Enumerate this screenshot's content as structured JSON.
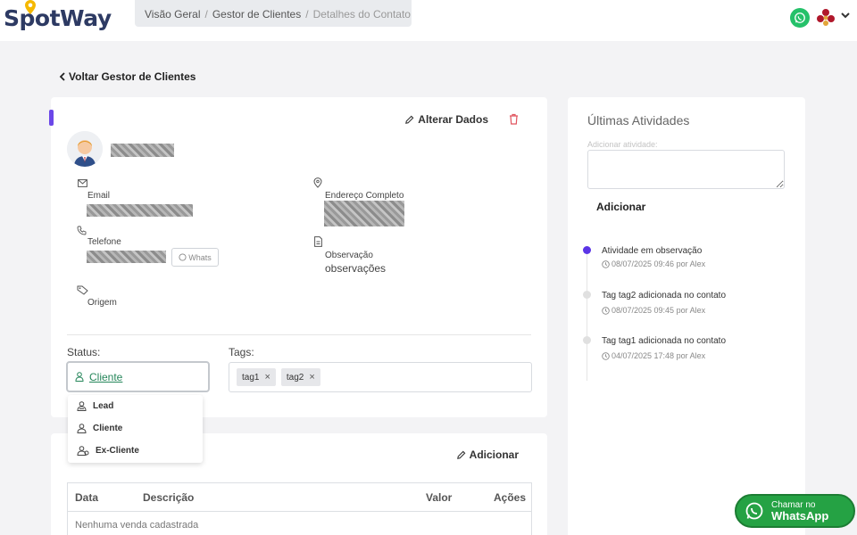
{
  "brand": {
    "name": "SpotWay",
    "accent": "#6b47e8",
    "green": "#25a244"
  },
  "breadcrumb": [
    "Visão Geral",
    "Gestor de Clientes",
    "Detalhes do Contato"
  ],
  "back_label": "Voltar Gestor de Clientes",
  "contact": {
    "alterar_label": "Alterar Dados",
    "email_label": "Email",
    "telefone_label": "Telefone",
    "whats_label": "Whats",
    "origem_label": "Origem",
    "endereco_label": "Endereço Completo",
    "observacao_label": "Observação",
    "observacao_value": "observações"
  },
  "status": {
    "label": "Status:",
    "selected": "Cliente",
    "options": [
      "Lead",
      "Cliente",
      "Ex-Cliente"
    ]
  },
  "tags": {
    "label": "Tags:",
    "items": [
      "tag1",
      "tag2"
    ],
    "remove_glyph": "×"
  },
  "sales": {
    "add_label": "Adicionar",
    "columns": [
      "Data",
      "Descrição",
      "Valor",
      "Ações"
    ],
    "empty": "Nenhuma venda cadastrada"
  },
  "activities": {
    "title": "Últimas Atividades",
    "input_label": "Adicionar atividade:",
    "add_label": "Adicionar",
    "items": [
      {
        "text": "Atividade em observação",
        "meta": "08/07/2025 09:46 por Alex"
      },
      {
        "text": "Tag tag2 adicionada no contato",
        "meta": "08/07/2025 09:45 por Alex"
      },
      {
        "text": "Tag tag1 adicionada no contato",
        "meta": "04/07/2025 17:48 por Alex"
      }
    ]
  },
  "whatsapp_float": {
    "line1": "Chamar no",
    "line2": "WhatsApp"
  }
}
